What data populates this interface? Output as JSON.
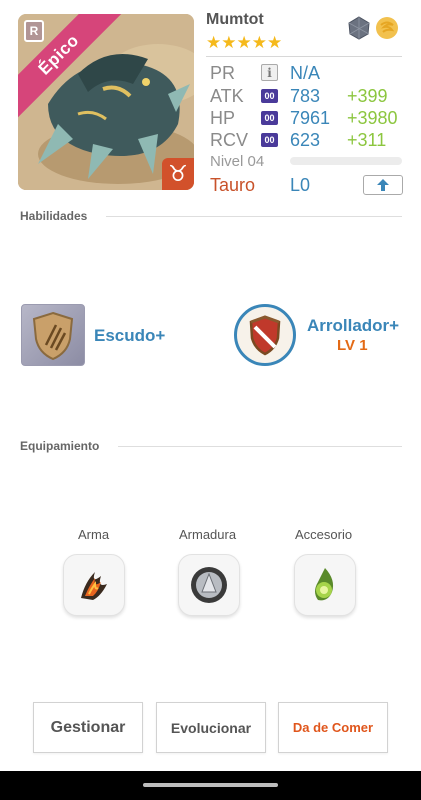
{
  "monster": {
    "name": "Mumtot",
    "rarity_label": "Épico",
    "rank_badge": "R",
    "zodiac_glyph": "♉",
    "stars": "★★★★★",
    "elements": [
      "rock-element-icon",
      "wind-element-icon"
    ]
  },
  "stats": {
    "pr": {
      "label": "PR",
      "value": "N/A",
      "icon": "i"
    },
    "atk": {
      "label": "ATK",
      "value": "783",
      "bonus": "+399",
      "badge": "00"
    },
    "hp": {
      "label": "HP",
      "value": "7961",
      "bonus": "+3980",
      "badge": "00"
    },
    "rcv": {
      "label": "RCV",
      "value": "623",
      "bonus": "+311",
      "badge": "00"
    },
    "level": {
      "label": "Nivel 04",
      "progress": 0.0
    },
    "sign": {
      "label": "Tauro",
      "value": "L0"
    }
  },
  "sections": {
    "skills_title": "Habilidades",
    "equipment_title": "Equipamiento"
  },
  "skills": [
    {
      "name": "Escudo+",
      "icon": "claw-shield-icon"
    },
    {
      "name": "Arrollador+",
      "level": "LV 1",
      "icon": "red-shield-icon"
    }
  ],
  "equipment": [
    {
      "label": "Arma",
      "icon": "fire-claw-weapon-icon"
    },
    {
      "label": "Armadura",
      "icon": "silver-armor-icon"
    },
    {
      "label": "Accesorio",
      "icon": "green-leaf-accessory-icon"
    }
  ],
  "actions": {
    "manage": "Gestionar",
    "evolve": "Evolucionar",
    "feed": "Da de Comer"
  },
  "colors": {
    "accent_blue": "#3a86b8",
    "bonus_green": "#8cc63f",
    "rarity_pink": "#d6457a",
    "sign_orange": "#c8522a",
    "star_gold": "#f5b91b",
    "feed_orange": "#e0561c"
  }
}
